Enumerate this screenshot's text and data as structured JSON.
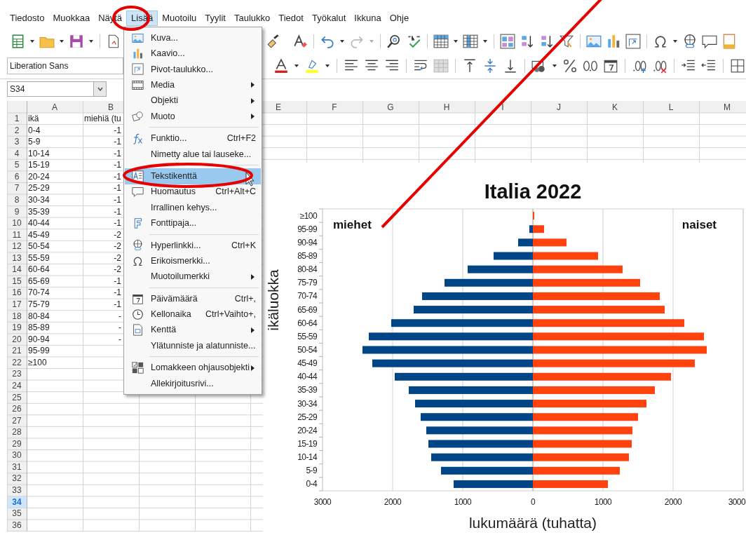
{
  "menu_bar": [
    {
      "label": "Tiedosto",
      "selected": false
    },
    {
      "label": "Muokkaa",
      "selected": false
    },
    {
      "label": "Näytä",
      "selected": false
    },
    {
      "label": "Lisää",
      "selected": true
    },
    {
      "label": "Muotoilu",
      "selected": false
    },
    {
      "label": "Tyylit",
      "selected": false
    },
    {
      "label": "Taulukko",
      "selected": false
    },
    {
      "label": "Tiedot",
      "selected": false
    },
    {
      "label": "Työkalut",
      "selected": false
    },
    {
      "label": "Ikkuna",
      "selected": false
    },
    {
      "label": "Ohje",
      "selected": false
    }
  ],
  "formatting_toolbar": {
    "font_name": "Liberation Sans"
  },
  "formula_bar": {
    "name_box": "S34"
  },
  "sheet": {
    "columns": [
      "A",
      "B",
      "E",
      "F",
      "G",
      "H",
      "I",
      "J",
      "K",
      "L",
      "M"
    ],
    "rows": [
      {
        "number": "1",
        "selected": false,
        "cells": [
          "ikä",
          "miehiä (tu"
        ]
      },
      {
        "number": "2",
        "selected": false,
        "cells": [
          "0-4",
          "-1"
        ]
      },
      {
        "number": "3",
        "selected": false,
        "cells": [
          "5-9",
          "-1"
        ]
      },
      {
        "number": "4",
        "selected": false,
        "cells": [
          "10-14",
          "-1"
        ]
      },
      {
        "number": "5",
        "selected": false,
        "cells": [
          "15-19",
          "-1"
        ]
      },
      {
        "number": "6",
        "selected": false,
        "cells": [
          "20-24",
          "-1"
        ]
      },
      {
        "number": "7",
        "selected": false,
        "cells": [
          "25-29",
          "-1"
        ]
      },
      {
        "number": "8",
        "selected": false,
        "cells": [
          "30-34",
          "-1"
        ]
      },
      {
        "number": "9",
        "selected": false,
        "cells": [
          "35-39",
          "-1"
        ]
      },
      {
        "number": "10",
        "selected": false,
        "cells": [
          "40-44",
          "-1"
        ]
      },
      {
        "number": "11",
        "selected": false,
        "cells": [
          "45-49",
          "-2"
        ]
      },
      {
        "number": "12",
        "selected": false,
        "cells": [
          "50-54",
          "-2"
        ]
      },
      {
        "number": "13",
        "selected": false,
        "cells": [
          "55-59",
          "-2"
        ]
      },
      {
        "number": "14",
        "selected": false,
        "cells": [
          "60-64",
          "-2"
        ]
      },
      {
        "number": "15",
        "selected": false,
        "cells": [
          "65-69",
          "-1"
        ]
      },
      {
        "number": "16",
        "selected": false,
        "cells": [
          "70-74",
          "-1"
        ]
      },
      {
        "number": "17",
        "selected": false,
        "cells": [
          "75-79",
          "-1"
        ]
      },
      {
        "number": "18",
        "selected": false,
        "cells": [
          "80-84",
          "-"
        ]
      },
      {
        "number": "19",
        "selected": false,
        "cells": [
          "85-89",
          "-"
        ]
      },
      {
        "number": "20",
        "selected": false,
        "cells": [
          "90-94",
          "-"
        ]
      },
      {
        "number": "21",
        "selected": false,
        "cells": [
          "95-99"
        ]
      },
      {
        "number": "22",
        "selected": false,
        "cells": [
          "≥100"
        ]
      },
      {
        "number": "23",
        "selected": false,
        "cells": []
      },
      {
        "number": "24",
        "selected": false,
        "cells": []
      },
      {
        "number": "25",
        "selected": false,
        "cells": []
      },
      {
        "number": "26",
        "selected": false,
        "cells": []
      },
      {
        "number": "27",
        "selected": false,
        "cells": []
      },
      {
        "number": "28",
        "selected": false,
        "cells": []
      },
      {
        "number": "29",
        "selected": false,
        "cells": []
      },
      {
        "number": "30",
        "selected": false,
        "cells": []
      },
      {
        "number": "31",
        "selected": false,
        "cells": []
      },
      {
        "number": "32",
        "selected": false,
        "cells": []
      },
      {
        "number": "33",
        "selected": false,
        "cells": []
      },
      {
        "number": "34",
        "selected": true,
        "cells": []
      },
      {
        "number": "35",
        "selected": false,
        "cells": []
      },
      {
        "number": "36",
        "selected": false,
        "cells": []
      }
    ]
  },
  "chart": {
    "chart_data": {
      "type": "bar",
      "orientation": "horizontal",
      "stacked": true,
      "title": "Italia 2022",
      "xlabel": "lukumäärä (tuhatta)",
      "ylabel": "ikäluokka",
      "categories": [
        "≥100",
        "95-99",
        "90-94",
        "85-89",
        "80-84",
        "75-79",
        "70-74",
        "65-69",
        "60-64",
        "55-59",
        "50-54",
        "45-49",
        "40-44",
        "35-39",
        "30-34",
        "25-29",
        "20-24",
        "15-19",
        "10-14",
        "5-9",
        "0-4"
      ],
      "series": [
        {
          "color": "#004586",
          "values": [
            0,
            -50,
            -210,
            -560,
            -930,
            -1260,
            -1580,
            -1700,
            -2020,
            -2340,
            -2430,
            -2290,
            -1970,
            -1770,
            -1680,
            -1600,
            -1520,
            -1490,
            -1450,
            -1310,
            -1130
          ]
        },
        {
          "color": "#ff420e",
          "values": [
            20,
            160,
            480,
            930,
            1280,
            1530,
            1810,
            1880,
            2160,
            2440,
            2480,
            2310,
            1970,
            1740,
            1620,
            1500,
            1420,
            1410,
            1370,
            1240,
            1070
          ]
        }
      ],
      "xlim": [
        -3000,
        3000
      ],
      "grid": true,
      "xticks": [
        {
          "value": -3000,
          "label": "3000"
        },
        {
          "value": -2000,
          "label": "2000"
        },
        {
          "value": -1000,
          "label": "1000"
        },
        0,
        1000,
        2000,
        3000
      ],
      "annotations": [
        {
          "text": "miehet"
        },
        {
          "text": "naiset"
        }
      ]
    }
  },
  "insert_menu": {
    "items": [
      {
        "kind": "item",
        "label": "Kuva...",
        "submenu": false,
        "selected": false
      },
      {
        "kind": "item",
        "label": "Kaavio...",
        "submenu": false,
        "selected": false
      },
      {
        "kind": "item",
        "label": "Pivot-taulukko...",
        "submenu": false,
        "selected": false
      },
      {
        "kind": "item",
        "label": "Media",
        "submenu": true,
        "selected": false
      },
      {
        "kind": "item",
        "label": "Objekti",
        "submenu": true,
        "selected": false
      },
      {
        "kind": "item",
        "label": "Muoto",
        "submenu": true,
        "selected": false
      },
      {
        "kind": "separator"
      },
      {
        "kind": "item",
        "label": "Funktio...",
        "shortcut": "Ctrl+F2",
        "submenu": false,
        "selected": false
      },
      {
        "kind": "item",
        "label": "Nimetty alue tai lauseke...",
        "submenu": false,
        "selected": false
      },
      {
        "kind": "separator"
      },
      {
        "kind": "item",
        "label": "Tekstikenttä",
        "submenu": false,
        "selected": true
      },
      {
        "kind": "item",
        "label": "Huomautus",
        "shortcut": "Ctrl+Alt+C",
        "submenu": false,
        "selected": false
      },
      {
        "kind": "item",
        "label": "Irrallinen kehys...",
        "submenu": false,
        "selected": false
      },
      {
        "kind": "item",
        "label": "Fonttipaja...",
        "submenu": false,
        "selected": false
      },
      {
        "kind": "separator"
      },
      {
        "kind": "item",
        "label": "Hyperlinkki...",
        "shortcut": "Ctrl+K",
        "submenu": false,
        "selected": false
      },
      {
        "kind": "item",
        "label": "Erikoismerkki...",
        "submenu": false,
        "selected": false
      },
      {
        "kind": "item",
        "label": "Muotoilumerkki",
        "submenu": true,
        "selected": false
      },
      {
        "kind": "separator"
      },
      {
        "kind": "item",
        "label": "Päivämäärä",
        "shortcut": "Ctrl+,",
        "submenu": false,
        "selected": false
      },
      {
        "kind": "item",
        "label": "Kellonaika",
        "shortcut": "Ctrl+Vaihto+,",
        "submenu": false,
        "selected": false
      },
      {
        "kind": "item",
        "label": "Kenttä",
        "submenu": true,
        "selected": false
      },
      {
        "kind": "item",
        "label": "Ylätunniste ja alatunniste...",
        "submenu": false,
        "selected": false
      },
      {
        "kind": "separator"
      },
      {
        "kind": "item",
        "label": "Lomakkeen ohjausobjekti",
        "submenu": true,
        "selected": false
      },
      {
        "kind": "item",
        "label": "Allekirjoitusrivi...",
        "submenu": false,
        "selected": false
      }
    ]
  }
}
